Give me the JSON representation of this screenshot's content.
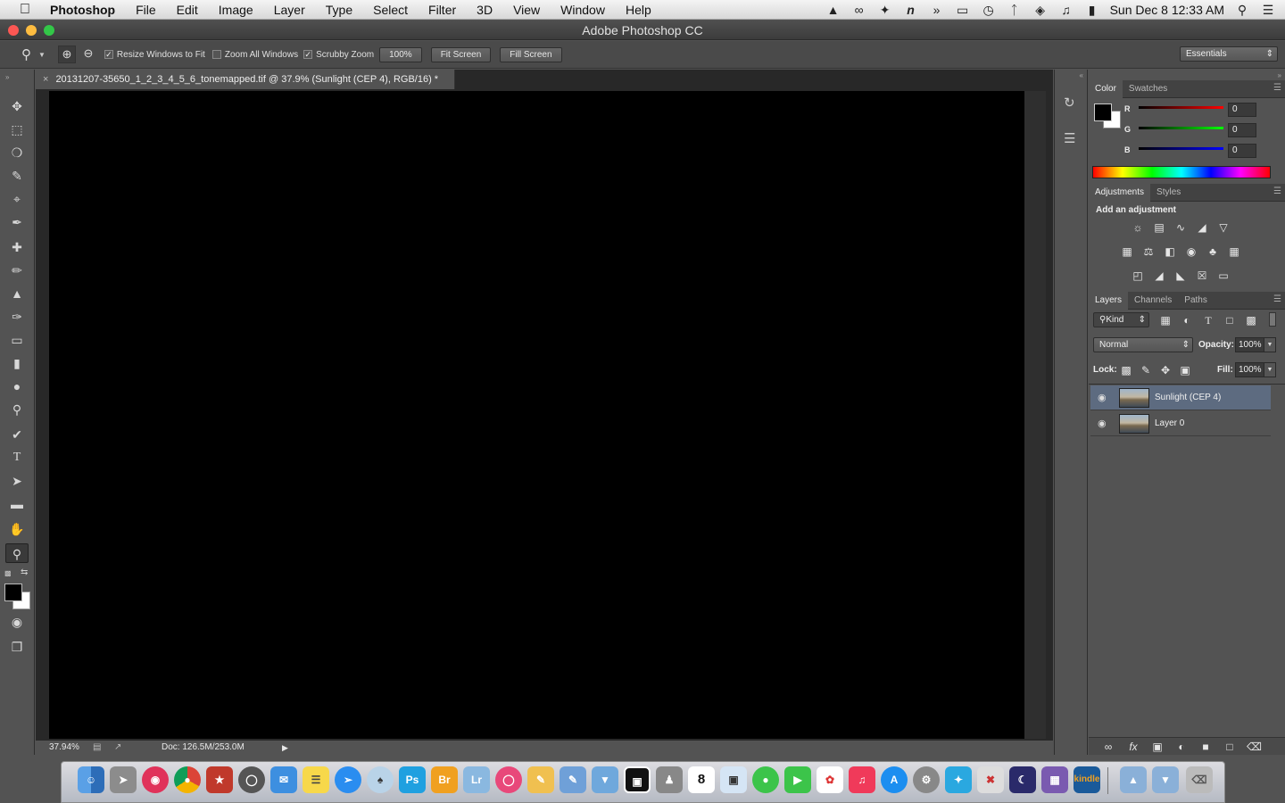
{
  "menubar": {
    "app_name": "Photoshop",
    "items": [
      "File",
      "Edit",
      "Image",
      "Layer",
      "Type",
      "Select",
      "Filter",
      "3D",
      "View",
      "Window",
      "Help"
    ],
    "clock": "Sun Dec 8  12:33 AM"
  },
  "window": {
    "title": "Adobe Photoshop CC"
  },
  "options": {
    "resize_windows": "Resize Windows to Fit",
    "zoom_all": "Zoom All Windows",
    "scrubby_zoom": "Scrubby Zoom",
    "zoom_value": "100%",
    "fit_screen": "Fit Screen",
    "fill_screen": "Fill Screen",
    "workspace": "Essentials"
  },
  "document": {
    "tab_title": "20131207-35650_1_2_3_4_5_6_tonemapped.tif @ 37.9% (Sunlight (CEP 4), RGB/16) *",
    "zoom": "37.94%",
    "doc_size": "Doc: 126.5M/253.0M"
  },
  "color_panel": {
    "tabs": [
      "Color",
      "Swatches"
    ],
    "r_label": "R",
    "g_label": "G",
    "b_label": "B",
    "r": "0",
    "g": "0",
    "b": "0"
  },
  "adjustments_panel": {
    "tabs": [
      "Adjustments",
      "Styles"
    ],
    "heading": "Add an adjustment"
  },
  "layers_panel": {
    "tabs": [
      "Layers",
      "Channels",
      "Paths"
    ],
    "filter": "Kind",
    "blend_mode": "Normal",
    "opacity_label": "Opacity:",
    "opacity": "100%",
    "lock_label": "Lock:",
    "fill_label": "Fill:",
    "fill": "100%",
    "layers": [
      {
        "name": "Sunlight (CEP 4)"
      },
      {
        "name": "Layer 0"
      }
    ]
  },
  "dock": {
    "calendar_day": "8",
    "ps_label": "Ps",
    "br_label": "Br",
    "lr_label": "Lr",
    "kindle_label": "kindle"
  },
  "colors": {
    "canvas": "#000000",
    "selected_layer": "#5d6b80",
    "panel_bg": "#535353"
  }
}
